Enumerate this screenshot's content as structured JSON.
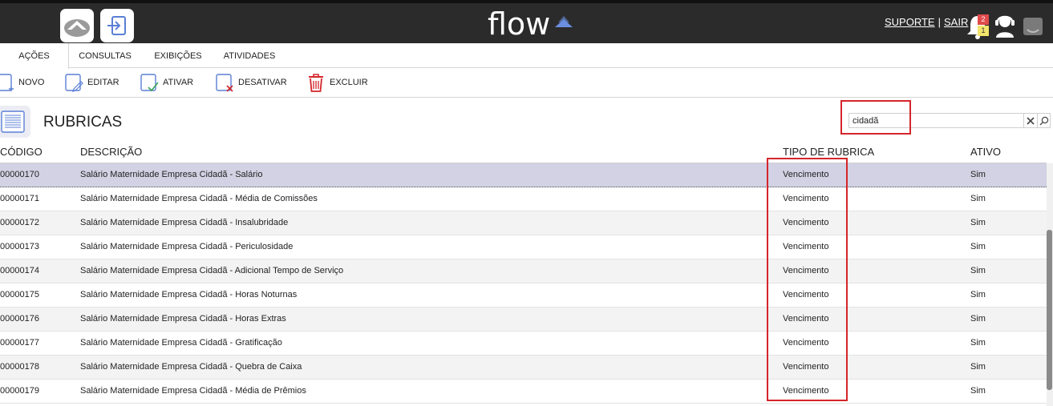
{
  "header": {
    "logo_text": "flow",
    "links": {
      "support": "SUPORTE",
      "separator": "|",
      "logout": "SAIR"
    },
    "notifications": {
      "red_count": "2",
      "yellow_count": "1"
    },
    "icons": [
      "home-cloud-icon",
      "login-icon",
      "bell-icon",
      "support-agent-icon",
      "chat-icon"
    ],
    "accent_color": "#6a8fe0"
  },
  "tabs": [
    {
      "label": "AÇÕES",
      "active": true
    },
    {
      "label": "CONSULTAS",
      "active": false
    },
    {
      "label": "EXIBIÇÕES",
      "active": false
    },
    {
      "label": "ATIVIDADES",
      "active": false
    }
  ],
  "toolbar": {
    "new_label": "NOVO",
    "edit_label": "EDITAR",
    "activate_label": "ATIVAR",
    "deactivate_label": "DESATIVAR",
    "delete_label": "EXCLUIR"
  },
  "page": {
    "title": "RUBRICAS",
    "search": {
      "value": "cidadã",
      "placeholder": ""
    }
  },
  "table": {
    "columns": [
      "CÓDIGO",
      "DESCRIÇÃO",
      "TIPO DE RUBRICA",
      "ATIVO"
    ],
    "rows": [
      {
        "code": "00000170",
        "description": "Salário Maternidade Empresa Cidadã - Salário",
        "type": "Vencimento",
        "active": "Sim"
      },
      {
        "code": "00000171",
        "description": "Salário Maternidade Empresa Cidadã - Média de Comissões",
        "type": "Vencimento",
        "active": "Sim"
      },
      {
        "code": "00000172",
        "description": "Salário Maternidade Empresa Cidadã - Insalubridade",
        "type": "Vencimento",
        "active": "Sim"
      },
      {
        "code": "00000173",
        "description": "Salário Maternidade Empresa Cidadã - Periculosidade",
        "type": "Vencimento",
        "active": "Sim"
      },
      {
        "code": "00000174",
        "description": "Salário Maternidade Empresa Cidadã - Adicional Tempo de Serviço",
        "type": "Vencimento",
        "active": "Sim"
      },
      {
        "code": "00000175",
        "description": "Salário Maternidade Empresa Cidadã - Horas Noturnas",
        "type": "Vencimento",
        "active": "Sim"
      },
      {
        "code": "00000176",
        "description": "Salário Maternidade Empresa Cidadã - Horas Extras",
        "type": "Vencimento",
        "active": "Sim"
      },
      {
        "code": "00000177",
        "description": "Salário Maternidade Empresa Cidadã - Gratificação",
        "type": "Vencimento",
        "active": "Sim"
      },
      {
        "code": "00000178",
        "description": "Salário Maternidade Empresa Cidadã - Quebra de Caixa",
        "type": "Vencimento",
        "active": "Sim"
      },
      {
        "code": "00000179",
        "description": "Salário Maternidade Empresa Cidadã - Média de Prêmios",
        "type": "Vencimento",
        "active": "Sim"
      }
    ],
    "selected_row": 0
  },
  "annotations": {
    "highlight_color": "#d4262b"
  }
}
